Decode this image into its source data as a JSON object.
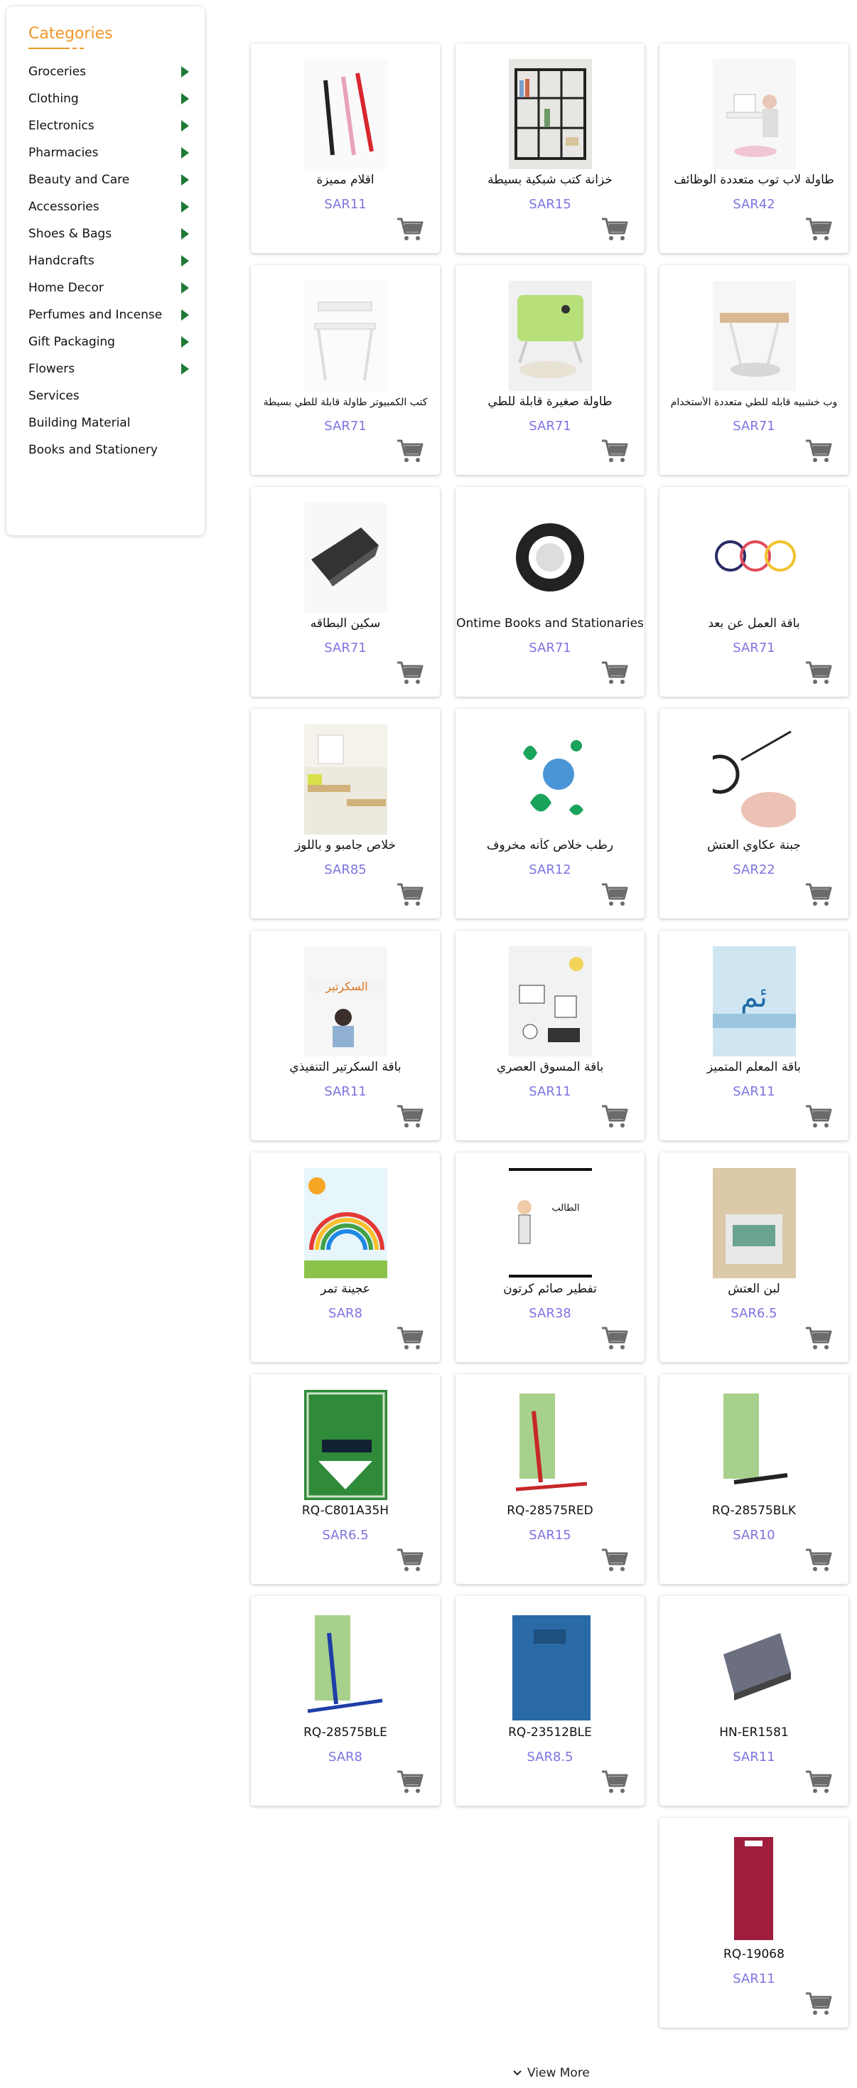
{
  "sidebar": {
    "title": "Categories",
    "items": [
      {
        "label": "Groceries",
        "has_sub": true
      },
      {
        "label": "Clothing",
        "has_sub": true
      },
      {
        "label": "Electronics",
        "has_sub": true
      },
      {
        "label": "Pharmacies",
        "has_sub": true
      },
      {
        "label": "Beauty and Care",
        "has_sub": true
      },
      {
        "label": "Accessories",
        "has_sub": true
      },
      {
        "label": "Shoes & Bags",
        "has_sub": true
      },
      {
        "label": "Handcrafts",
        "has_sub": true
      },
      {
        "label": "Home Decor",
        "has_sub": true
      },
      {
        "label": "Perfumes and Incense",
        "has_sub": true
      },
      {
        "label": "Gift Packaging",
        "has_sub": true
      },
      {
        "label": "Flowers",
        "has_sub": true
      },
      {
        "label": "Services",
        "has_sub": false
      },
      {
        "label": "Building Material",
        "has_sub": false
      },
      {
        "label": "Books and Stationery",
        "has_sub": false
      }
    ]
  },
  "products": [
    {
      "name": "طاولة لاب توب متعددة الوظائف",
      "price": "SAR42",
      "image": "laptop-table-image"
    },
    {
      "name": "خزانة كتب شبكية بسيطة",
      "price": "SAR15",
      "image": "bookshelf-image"
    },
    {
      "name": "اقلام مميزة",
      "price": "SAR11",
      "image": "pens-image"
    },
    {
      "name": "وب خشبيه قابله للطي متعددة الأستخدام",
      "price": "SAR71",
      "image": "wooden-folding-table-image"
    },
    {
      "name": "طاولة صغيرة قابلة للطي",
      "price": "SAR71",
      "image": "green-folding-table-image"
    },
    {
      "name": "كتب الكمبيوتر طاولة قابلة للطي بسيطة",
      "price": "SAR71",
      "image": "white-computer-desk-image"
    },
    {
      "name": "باقة العمل عن بعد",
      "price": "SAR71",
      "image": "remote-work-image"
    },
    {
      "name": "Ontime Books and Stationaries",
      "price": "SAR71",
      "image": "ontime-logo-image"
    },
    {
      "name": "سكين البطاقه",
      "price": "SAR71",
      "image": "card-knife-image"
    },
    {
      "name": "جبنة عكاوي العتش",
      "price": "SAR22",
      "image": "hand-writing-image"
    },
    {
      "name": "رطب خلاص كأنه مخروف",
      "price": "SAR12",
      "image": "eco-icons-image"
    },
    {
      "name": "خلاص جامبو و باللوز",
      "price": "SAR85",
      "image": "desks-room-image"
    },
    {
      "name": "باقة المعلم المتميز",
      "price": "SAR11",
      "image": "teacher-banner-image"
    },
    {
      "name": "باقة المسوق العصري",
      "price": "SAR11",
      "image": "marketing-image"
    },
    {
      "name": "باقة السكرتير التنفيذي",
      "price": "SAR11",
      "image": "secretary-image"
    },
    {
      "name": "لبن العتش",
      "price": "SAR6.5",
      "image": "envelope-image"
    },
    {
      "name": "تفطير صائم كرتون",
      "price": "SAR38",
      "image": "student-cartoon-image"
    },
    {
      "name": "عجينة تمر",
      "price": "SAR8",
      "image": "kids-rainbow-image"
    },
    {
      "name": "RQ-28575BLK",
      "price": "SAR10",
      "image": "marker-black-image"
    },
    {
      "name": "RQ-28575RED",
      "price": "SAR15",
      "image": "marker-red-image"
    },
    {
      "name": "RQ-C801A35H",
      "price": "SAR6.5",
      "image": "roco-paper-image"
    },
    {
      "name": "HN-ER1581",
      "price": "SAR11",
      "image": "eraser-image"
    },
    {
      "name": "RQ-23512BLE",
      "price": "SAR8.5",
      "image": "blue-notebook-image"
    },
    {
      "name": "RQ-28575BLE",
      "price": "SAR8",
      "image": "marker-blue-image"
    },
    {
      "name": "RQ-19068",
      "price": "SAR11",
      "image": "red-notebook-image"
    }
  ],
  "view_more_label": "View More",
  "colors": {
    "accent": "#f0972a",
    "price": "#7d74e0",
    "arrow": "#1f7a35",
    "cart": "#6b6b6b"
  }
}
